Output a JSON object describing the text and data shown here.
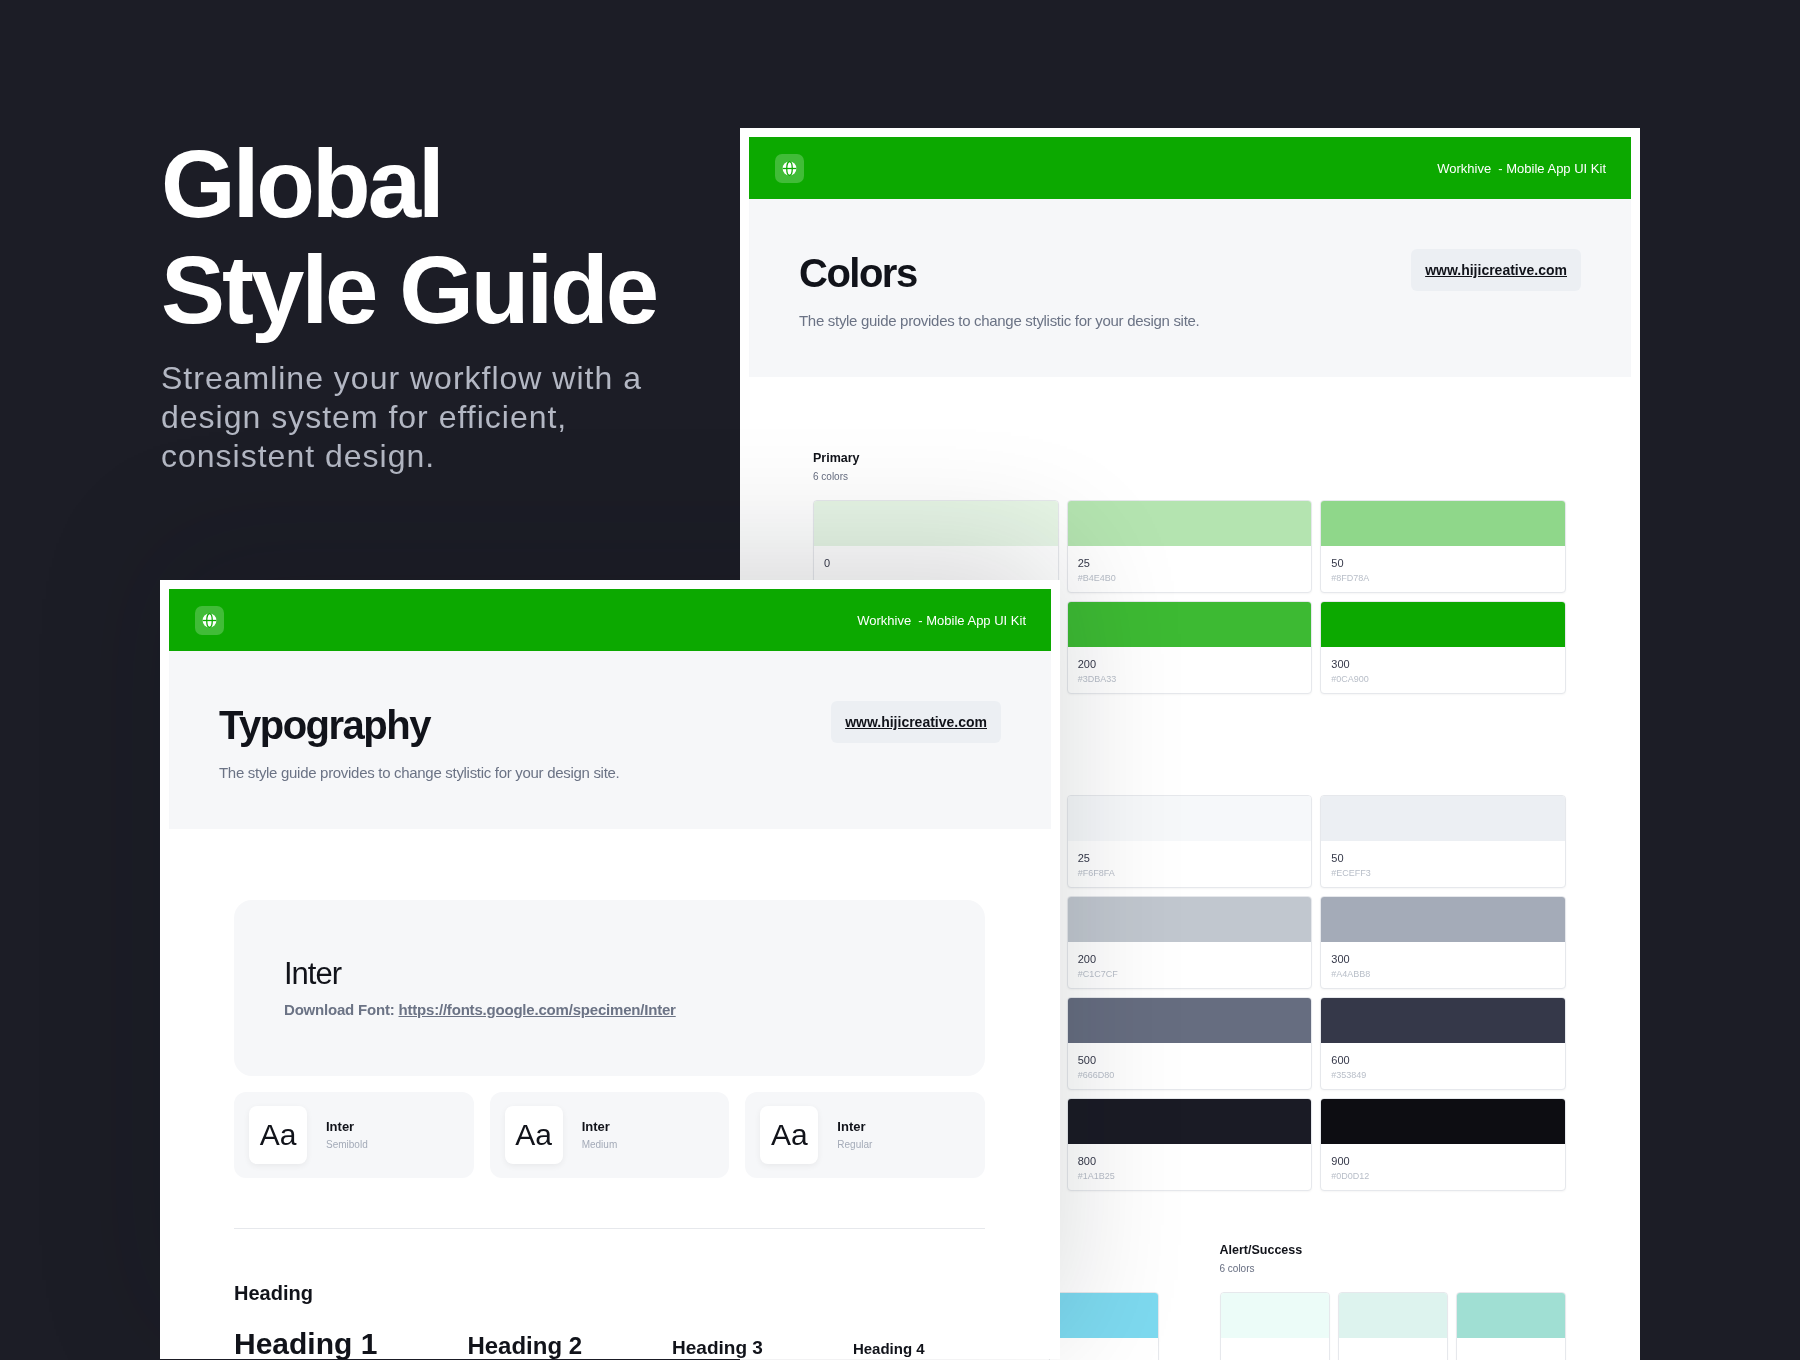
{
  "hero": {
    "title": "Global Style Guide",
    "subtitle": "Streamline your workflow with a design system for efficient, consistent design."
  },
  "colors_card": {
    "header": {
      "brand": "Workhive  - Mobile App UI Kit"
    },
    "title": "Colors",
    "description": "The style guide provides to change stylistic for your design site.",
    "link": "www.hijicreative.com",
    "sections": [
      {
        "groups": [
          {
            "title": "Primary",
            "count": "6 colors",
            "rows": [
              [
                {
                  "label": "0",
                  "color": "#e7f6e6"
                },
                {
                  "label": "25",
                  "hex": "#B4E4B0",
                  "color": "#b4e4b0"
                },
                {
                  "label": "50",
                  "hex": "#8FD78A",
                  "color": "#8fd78a"
                }
              ],
              [
                "",
                {
                  "label": "200",
                  "hex": "#3DBA33",
                  "color": "#3dba33"
                },
                {
                  "label": "300",
                  "hex": "#0CA900",
                  "color": "#0ca900"
                }
              ]
            ]
          }
        ]
      },
      {
        "groups": [
          {
            "rows": [
              [
                "",
                {
                  "label": "25",
                  "hex": "#F6F8FA",
                  "color": "#f6f8fa"
                },
                {
                  "label": "50",
                  "hex": "#ECEFF3",
                  "color": "#eceff3"
                }
              ],
              [
                "",
                {
                  "label": "200",
                  "hex": "#C1C7CF",
                  "color": "#c1c7cf"
                },
                {
                  "label": "300",
                  "hex": "#A4ABB8",
                  "color": "#a4abb8"
                }
              ],
              [
                "",
                {
                  "label": "500",
                  "hex": "#666D80",
                  "color": "#666d80"
                },
                {
                  "label": "600",
                  "hex": "#353849",
                  "color": "#353849"
                }
              ],
              [
                "",
                {
                  "label": "800",
                  "hex": "#1A1B25",
                  "color": "#1a1b25"
                },
                {
                  "label": "900",
                  "hex": "#0D0D12",
                  "color": "#0d0d12"
                }
              ]
            ]
          }
        ]
      },
      {
        "groups": [
          {
            "rows": [
              [
                "",
                "",
                {
                  "color": "#7dd9ef"
                }
              ]
            ]
          },
          {
            "title": "Alert/Success",
            "count": "6 colors",
            "rows": [
              [
                {
                  "color": "#ecfcf8"
                },
                {
                  "color": "#ddf3ee"
                },
                {
                  "color": "#a0dfd3"
                }
              ]
            ]
          }
        ]
      }
    ]
  },
  "typography_card": {
    "header": {
      "brand": "Workhive  - Mobile App UI Kit"
    },
    "title": "Typography",
    "description": "The style guide provides to change stylistic for your design site.",
    "link": "www.hijicreative.com",
    "font": {
      "name": "Inter",
      "download_label": "Download Font:",
      "download_link": "https://fonts.google.com/specimen/Inter"
    },
    "weights": [
      {
        "sample": "Aa",
        "name": "Inter",
        "weight": "Semibold"
      },
      {
        "sample": "Aa",
        "name": "Inter",
        "weight": "Medium"
      },
      {
        "sample": "Aa",
        "name": "Inter",
        "weight": "Regular"
      }
    ],
    "headings": {
      "title": "Heading",
      "items": [
        "Heading 1",
        "Heading 2",
        "Heading 3",
        "Heading 4"
      ]
    }
  }
}
